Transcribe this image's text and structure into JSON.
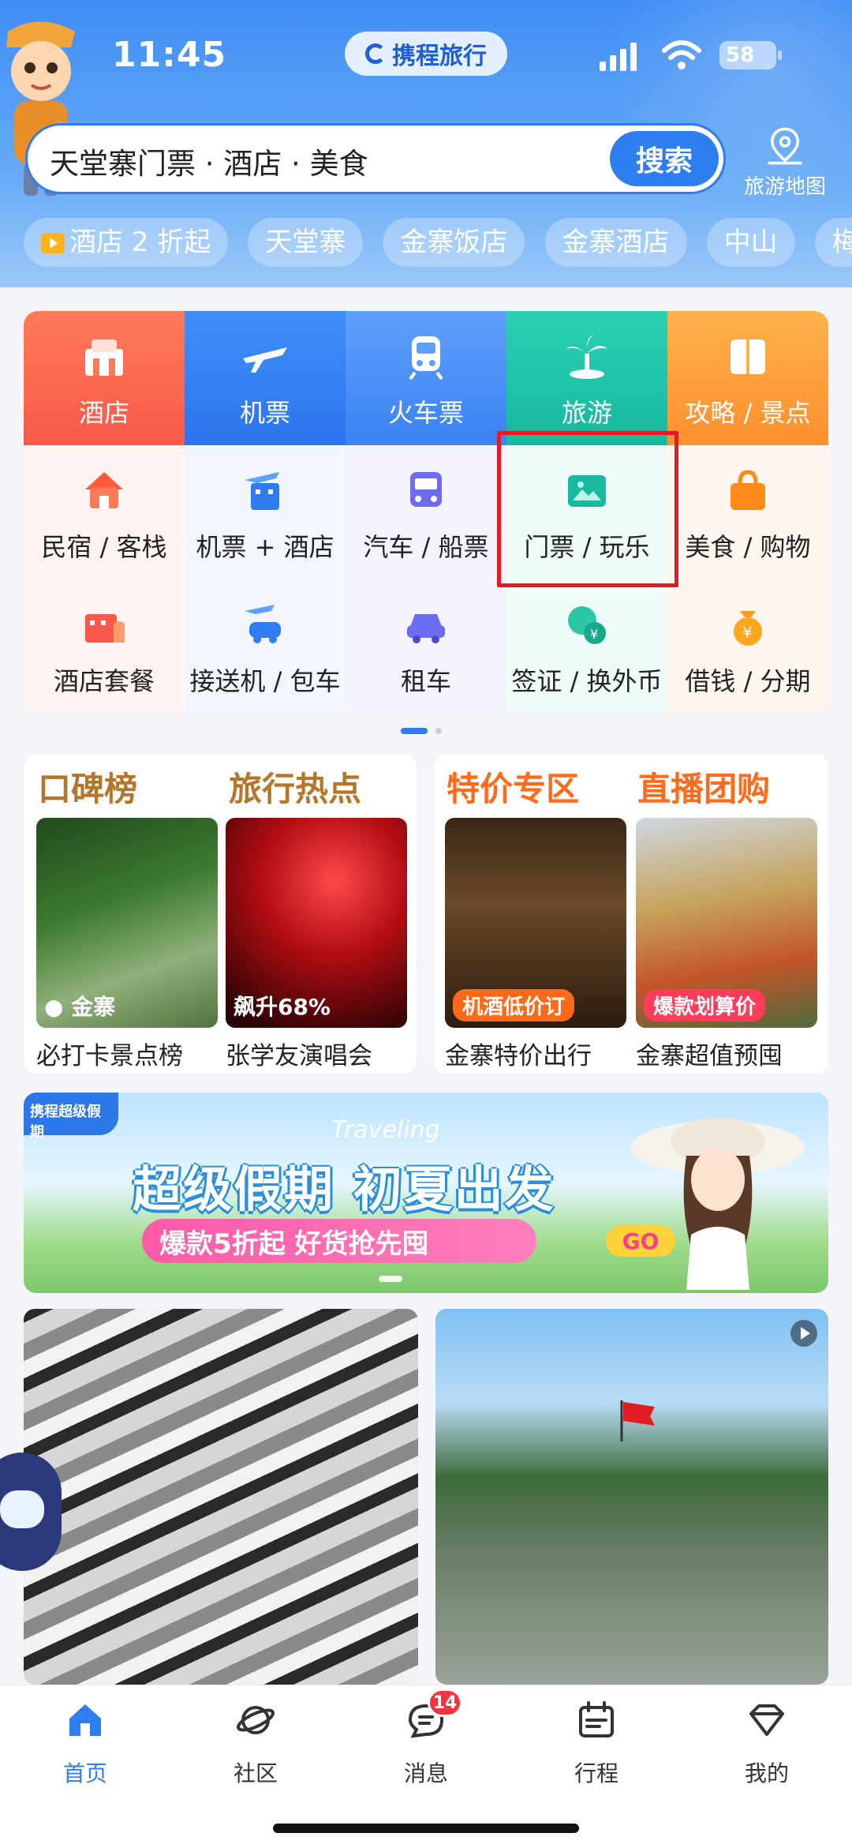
{
  "status": {
    "time": "11:45",
    "battery": "58"
  },
  "brand": {
    "name": "携程旅行"
  },
  "search": {
    "value": "天堂寨门票 · 酒店 · 美食",
    "button": "搜索"
  },
  "map": {
    "label": "旅游地图"
  },
  "chips": [
    "酒店 2 折起",
    "天堂寨",
    "金寨饭店",
    "金寨酒店",
    "中山",
    "梅"
  ],
  "grid": {
    "row1": [
      "酒店",
      "机票",
      "火车票",
      "旅游",
      "攻略 / 景点"
    ],
    "row2": [
      "民宿 / 客栈",
      "机票 + 酒店",
      "汽车 / 船票",
      "门票 / 玩乐",
      "美食 / 购物"
    ],
    "row3": [
      "酒店套餐",
      "接送机 / 包车",
      "租车",
      "签证 / 换外币",
      "借钱 / 分期"
    ]
  },
  "cards": {
    "left": {
      "h1": "口碑榜",
      "h2": "旅行热点",
      "tile1": {
        "badge": "金寨",
        "caption": "必打卡景点榜"
      },
      "tile2": {
        "badge": "飙升68%",
        "caption": "张学友演唱会"
      }
    },
    "right": {
      "h1": "特价专区",
      "h2": "直播团购",
      "tile1": {
        "tag": "机酒低价订",
        "caption": "金寨特价出行"
      },
      "tile2": {
        "tag": "爆款划算价",
        "caption": "金寨超值预囤"
      }
    }
  },
  "banner": {
    "logo": "携程超级假期",
    "title": "超级假期 初夏出发",
    "script": "Traveling",
    "pill": "爆款5折起 好货抢先囤",
    "go": "GO"
  },
  "nav": [
    {
      "label": "首页",
      "icon": "home-icon",
      "active": true
    },
    {
      "label": "社区",
      "icon": "planet-icon"
    },
    {
      "label": "消息",
      "icon": "message-icon",
      "badge": "14"
    },
    {
      "label": "行程",
      "icon": "calendar-icon"
    },
    {
      "label": "我的",
      "icon": "diamond-icon"
    }
  ],
  "colors": {
    "accent": "#2e7ef2",
    "highlight": "#e11c24",
    "gold": "#b3762a",
    "orange": "#ff6b1d"
  }
}
